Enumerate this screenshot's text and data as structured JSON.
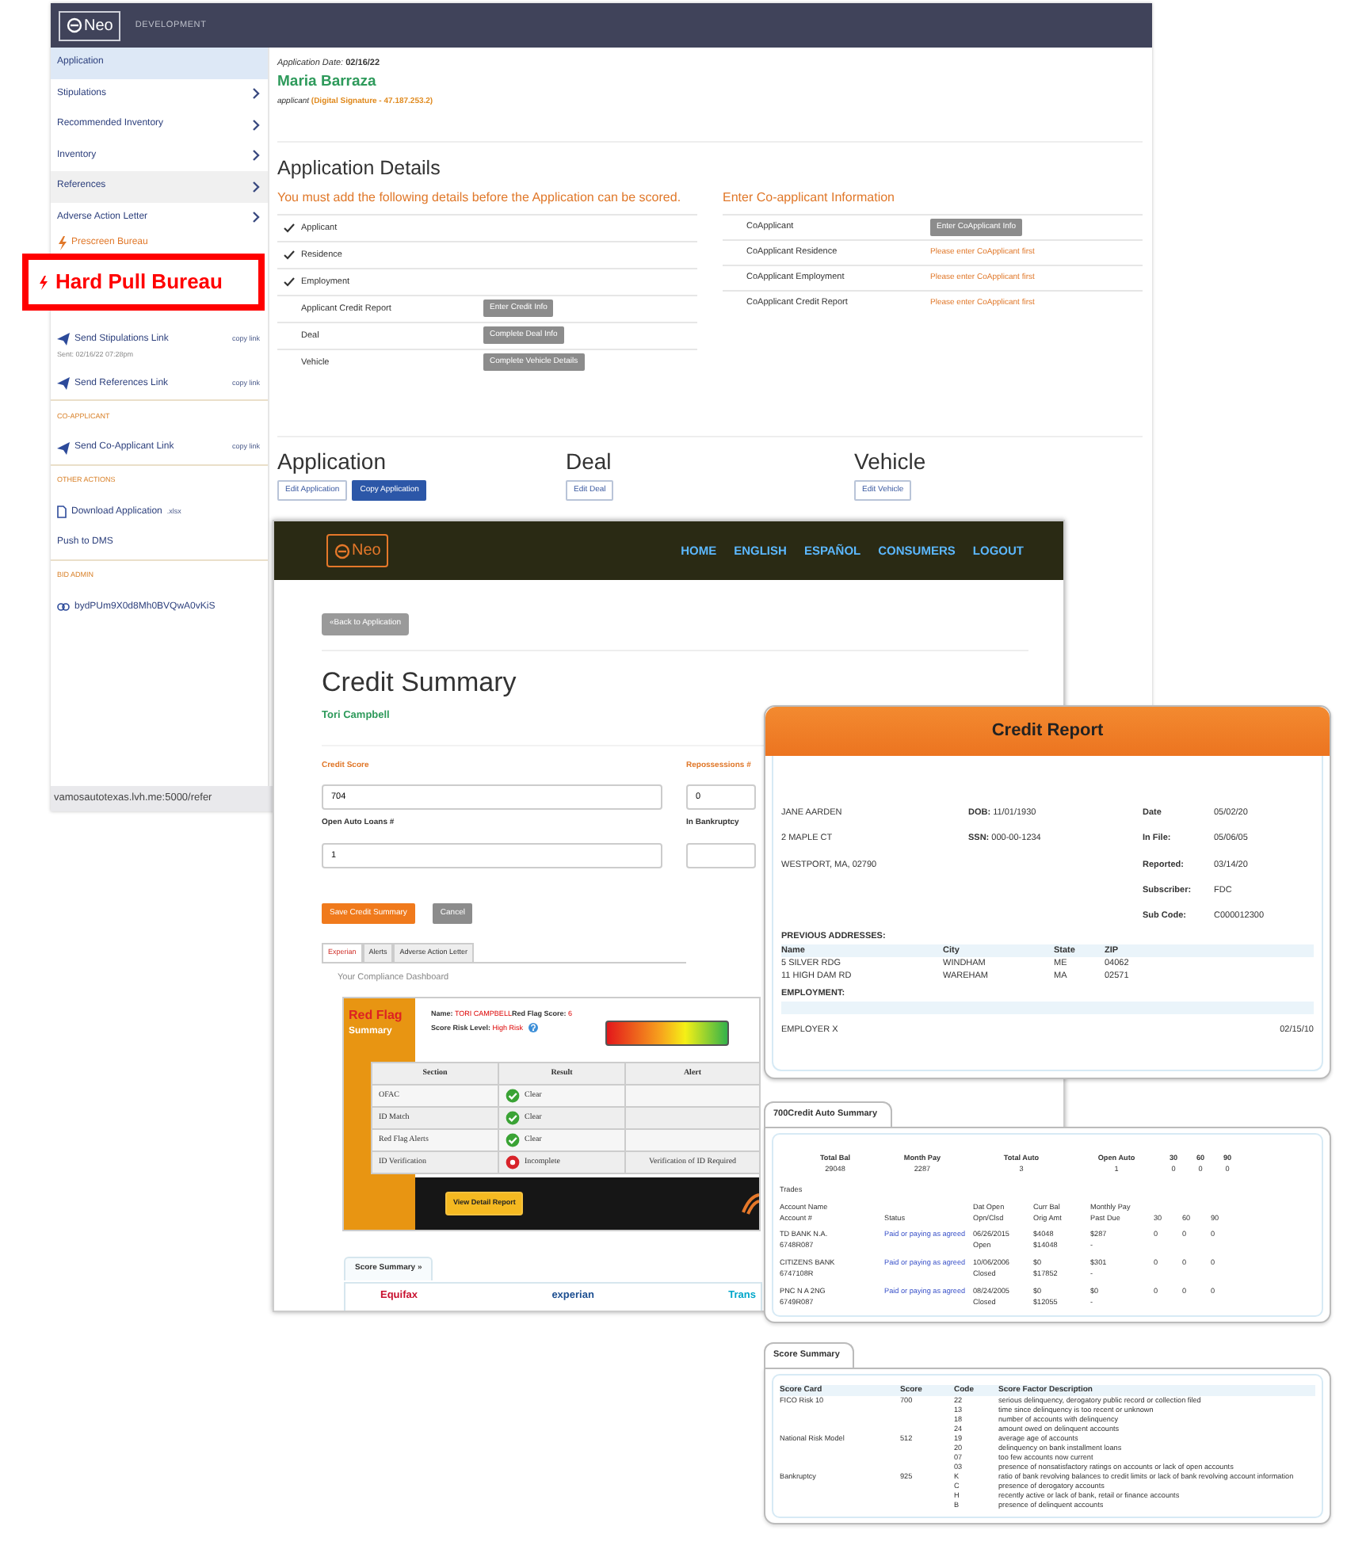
{
  "callout": {
    "label": "Hard Pull Bureau"
  },
  "admin_app": {
    "brand": "Neo",
    "environment": "DEVELOPMENT",
    "sidebar": [
      {
        "kind": "page",
        "label": "Application",
        "selected": true,
        "hovered": false
      },
      {
        "kind": "section",
        "label": "Stipulations",
        "selected": false,
        "hovered": false
      },
      {
        "kind": "section",
        "label": "Recommended Inventory",
        "selected": false,
        "hovered": false
      },
      {
        "kind": "section",
        "label": "Inventory",
        "selected": false,
        "hovered": false
      },
      {
        "kind": "section",
        "label": "References",
        "selected": false,
        "hovered": true
      },
      {
        "kind": "section",
        "label": "Adverse Action Letter",
        "selected": false,
        "hovered": false
      },
      {
        "kind": "action",
        "label": "Prescreen Bureau"
      },
      {
        "kind": "send",
        "label": "Send Stipulations Link",
        "action": "copy link",
        "note": "Sent: 02/16/22 07:28pm"
      },
      {
        "kind": "send",
        "label": "Send References Link",
        "action": "copy link"
      },
      {
        "kind": "heading",
        "label": "CO-APPLICANT"
      },
      {
        "kind": "send",
        "label": "Send Co-Applicant Link",
        "action": "copy link"
      },
      {
        "kind": "heading",
        "label": "OTHER ACTIONS"
      },
      {
        "kind": "file",
        "label": "Download Application",
        "suffix": ".xlsx"
      },
      {
        "kind": "plain",
        "label": "Push to DMS"
      },
      {
        "kind": "heading",
        "label": "BID ADMIN"
      },
      {
        "kind": "link",
        "label": "bydPUm9X0d8Mh0BVQwA0vKiS"
      }
    ],
    "status_url": "vamosautotexas.lvh.me:5000/refer",
    "date_label": "Application Date:",
    "date": "02/16/22",
    "applicant_name": "Maria Barraza",
    "role": "applicant",
    "signature": "(Digital Signature - 47.187.253.2)",
    "details": {
      "title": "Application Details",
      "warning": "You must add the following details before the Application can be scored.",
      "checklist": [
        {
          "label": "Applicant",
          "done": true
        },
        {
          "label": "Residence",
          "done": true
        },
        {
          "label": "Employment",
          "done": true
        },
        {
          "label": "Applicant Credit Report",
          "done": false,
          "button": "Enter Credit Info"
        },
        {
          "label": "Deal",
          "done": false,
          "button": "Complete Deal Info"
        },
        {
          "label": "Vehicle",
          "done": false,
          "button": "Complete Vehicle Details"
        }
      ]
    },
    "coapplicant": {
      "title": "Enter Co-applicant Information",
      "rows": [
        {
          "label": "CoApplicant",
          "kind": "button",
          "value": "Enter CoApplicant Info"
        },
        {
          "label": "CoApplicant Residence",
          "kind": "notice",
          "value": "Please enter CoApplicant first"
        },
        {
          "label": "CoApplicant Employment",
          "kind": "notice",
          "value": "Please enter CoApplicant first"
        },
        {
          "label": "CoApplicant Credit Report",
          "kind": "notice",
          "value": "Please enter CoApplicant first"
        }
      ]
    },
    "sections": [
      {
        "title": "Application",
        "buttons": [
          {
            "label": "Edit Application",
            "primary": false
          },
          {
            "label": "Copy Application",
            "primary": true
          }
        ]
      },
      {
        "title": "Deal",
        "buttons": [
          {
            "label": "Edit Deal",
            "primary": false
          }
        ]
      },
      {
        "title": "Vehicle",
        "buttons": [
          {
            "label": "Edit Vehicle",
            "primary": false
          }
        ]
      }
    ]
  },
  "credit_app": {
    "brand": "Neo",
    "nav": [
      "HOME",
      "ENGLISH",
      "ESPAÑOL",
      "CONSUMERS",
      "LOGOUT"
    ],
    "back_button": "«Back to Application",
    "title": "Credit Summary",
    "person": "Tori Campbell",
    "fields": [
      {
        "label": "Credit Score",
        "value": "704",
        "highlight": true
      },
      {
        "label": "Repossessions #",
        "value": "0",
        "highlight": true
      },
      {
        "label": "Open Auto Loans #",
        "value": "1",
        "highlight": false
      },
      {
        "label": "In Bankruptcy",
        "highlight": false
      }
    ],
    "save_button": "Save Credit Summary",
    "cancel_button": "Cancel",
    "tabs": [
      {
        "label": "Experian",
        "selected": true
      },
      {
        "label": "Alerts",
        "selected": false
      },
      {
        "label": "Adverse Action Letter",
        "selected": false
      }
    ],
    "dashboard_title": "Your Compliance Dashboard",
    "red_flag": {
      "title": "Red Flag",
      "subtitle": "Summary",
      "info": [
        {
          "label": "Name:",
          "value": "TORI CAMPBELL"
        },
        {
          "label": "Red Flag Score:",
          "value": "6"
        },
        {
          "label": "Score Risk Level:",
          "value": "High Risk"
        }
      ],
      "columns": [
        "Section",
        "Result",
        "Alert"
      ],
      "rows": [
        {
          "section": "OFAC",
          "result": "Clear",
          "passed": true
        },
        {
          "section": "ID Match",
          "result": "Clear",
          "passed": true
        },
        {
          "section": "Red Flag Alerts",
          "result": "Clear",
          "passed": true
        },
        {
          "section": "ID Verification",
          "result": "Incomplete",
          "passed": false,
          "alert": "Verification of ID Required"
        }
      ],
      "detail_button": "View Detail Report"
    },
    "score_summary": {
      "tab": "Score Summary »",
      "bureaus": [
        {
          "label": "Equifax",
          "color": "#c8102e"
        },
        {
          "label": "experian",
          "color": "#1d4f91"
        },
        {
          "label": "Trans",
          "color": "#00a6ca"
        }
      ]
    }
  },
  "credit_report": {
    "title": "Credit Report",
    "consumer": [
      "JANE AARDEN",
      "2 MAPLE CT",
      "WESTPORT, MA, 02790"
    ],
    "ids": [
      {
        "label": "DOB:",
        "value": "11/01/1930"
      },
      {
        "label": "SSN:",
        "value": "000-00-1234"
      }
    ],
    "report_info": [
      {
        "label": "Date",
        "value": "05/02/20"
      },
      {
        "label": "In File:",
        "value": "05/06/05"
      },
      {
        "label": "Reported:",
        "value": "03/14/20"
      },
      {
        "label": "Subscriber:",
        "value": "FDC"
      },
      {
        "label": "Sub Code:",
        "value": "C000012300"
      }
    ],
    "previous_addresses": {
      "title": "PREVIOUS ADDRESSES:",
      "columns": [
        "Name",
        "City",
        "State",
        "ZIP"
      ],
      "rows": [
        [
          "5 SILVER RDG",
          "WINDHAM",
          "ME",
          "04062"
        ],
        [
          "11 HIGH DAM RD",
          "WAREHAM",
          "MA",
          "02571"
        ]
      ]
    },
    "employment": {
      "title": "EMPLOYMENT:",
      "employer": "EMPLOYER X",
      "date": "02/15/10"
    },
    "auto_summary": {
      "tab": "700Credit Auto Summary",
      "totals": [
        {
          "label": "Total Bal",
          "value": "29048"
        },
        {
          "label": "Month Pay",
          "value": "2287"
        },
        {
          "label": "Total Auto",
          "value": "3"
        },
        {
          "label": "Open Auto",
          "value": "1"
        },
        {
          "label": "30",
          "value": "0"
        },
        {
          "label": "60",
          "value": "0"
        },
        {
          "label": "90",
          "value": "0"
        }
      ],
      "trades_label": "Trades",
      "columns": [
        {
          "lines": [
            "Account Name",
            "Account #"
          ]
        },
        {
          "lines": [
            "Status"
          ]
        },
        {
          "lines": [
            "Dat Open",
            "Opn/Clsd"
          ]
        },
        {
          "lines": [
            "Curr Bal",
            "Orig Amt"
          ]
        },
        {
          "lines": [
            "Monthly Pay",
            "Past Due"
          ]
        },
        {
          "lines": [
            "30"
          ]
        },
        {
          "lines": [
            "60"
          ]
        },
        {
          "lines": [
            "90"
          ]
        }
      ],
      "rows": [
        [
          [
            "TD BANK N.A.",
            "6748R087"
          ],
          [
            "Paid or paying as agreed"
          ],
          [
            "06/26/2015",
            "Open"
          ],
          [
            "$4048",
            "$14048"
          ],
          [
            "$287",
            "-"
          ],
          [
            "0"
          ],
          [
            "0"
          ],
          [
            "0"
          ]
        ],
        [
          [
            "CITIZENS BANK",
            "6747108R"
          ],
          [
            "Paid or paying as agreed"
          ],
          [
            "10/06/2006",
            "Closed"
          ],
          [
            "$0",
            "$17852"
          ],
          [
            "$301",
            "-"
          ],
          [
            "0"
          ],
          [
            "0"
          ],
          [
            "0"
          ]
        ],
        [
          [
            "PNC N A 2NG",
            "6749R087"
          ],
          [
            "Paid or paying as agreed"
          ],
          [
            "08/24/2005",
            "Closed"
          ],
          [
            "$0",
            "$12055"
          ],
          [
            "$0",
            "-"
          ],
          [
            "0"
          ],
          [
            "0"
          ],
          [
            "0"
          ]
        ]
      ]
    },
    "score_summary": {
      "tab": "Score Summary",
      "columns": [
        "Score Card",
        "Score",
        "Code",
        "Score Factor Description"
      ],
      "cards": [
        {
          "name": "FICO Risk 10",
          "score": "700",
          "factors": [
            {
              "code": "22",
              "text": "serious delinquency, derogatory public record or collection filed"
            },
            {
              "code": "13",
              "text": "time since delinquency is too recent or unknown"
            },
            {
              "code": "18",
              "text": "number of accounts with delinquency"
            },
            {
              "code": "24",
              "text": "amount owed on delinquent accounts"
            }
          ]
        },
        {
          "name": "National Risk Model",
          "score": "512",
          "factors": [
            {
              "code": "19",
              "text": "average age of accounts"
            },
            {
              "code": "20",
              "text": "delinquency on bank installment loans"
            },
            {
              "code": "07",
              "text": "too few accounts now current"
            },
            {
              "code": "03",
              "text": "presence of nonsatisfactory ratings on accounts or lack of open accounts"
            }
          ]
        },
        {
          "name": "Bankruptcy",
          "score": "925",
          "factors": [
            {
              "code": "K",
              "text": "ratio of bank revolving balances to credit limits or lack of bank revolving account information"
            },
            {
              "code": "C",
              "text": "presence of derogatory accounts"
            },
            {
              "code": "H",
              "text": "recently active or lack of bank, retail or finance accounts"
            },
            {
              "code": "B",
              "text": "presence of delinquent accounts"
            }
          ]
        }
      ]
    }
  }
}
